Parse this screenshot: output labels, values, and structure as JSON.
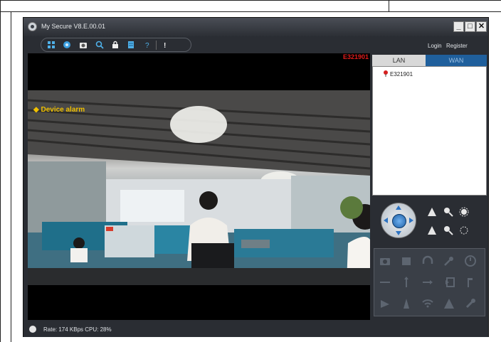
{
  "window": {
    "title": "My Secure  V8.E.00.01",
    "minimize_label": "_",
    "maximize_label": "□",
    "close_label": "✕"
  },
  "toolbar": {
    "icons": [
      "device-list-icon",
      "preview-icon",
      "snapshot-icon",
      "search-icon",
      "lock-icon",
      "storage-icon",
      "help-icon",
      "info-icon"
    ]
  },
  "header_links": {
    "login": "Login",
    "register": "Register"
  },
  "video": {
    "camera_id": "E321901",
    "alarm_text": "◆ Device alarm"
  },
  "panel": {
    "tab_lan": "LAN",
    "tab_wan": "WAN",
    "active_tab": "LAN",
    "device_tree": [
      {
        "label": "E321901",
        "status_color": "#d62020"
      }
    ]
  },
  "status": {
    "text": "Rate: 174 KBps  CPU:  28%"
  }
}
